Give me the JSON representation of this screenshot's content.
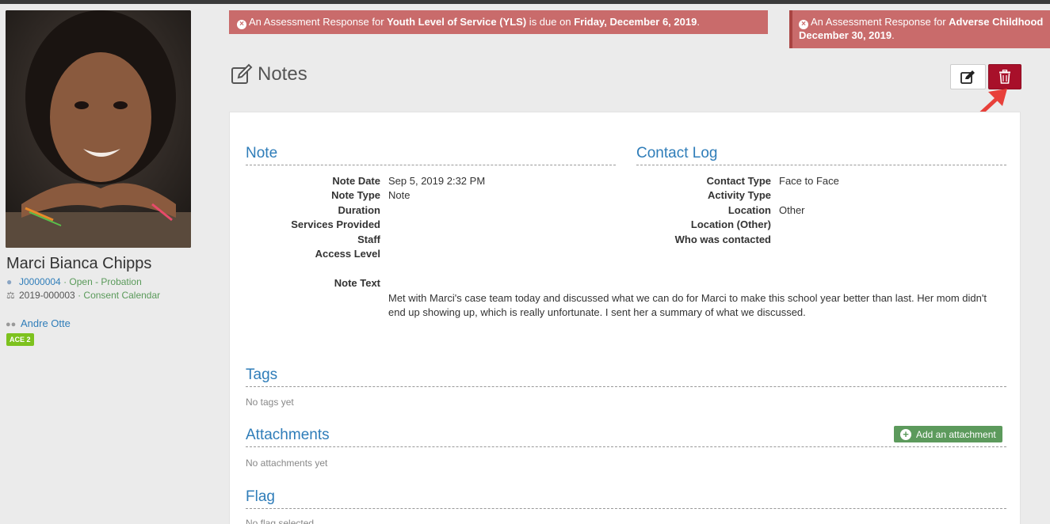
{
  "alerts": [
    {
      "prefix": "An Assessment Response for ",
      "assessment": "Youth Level of Service (YLS)",
      "middle": " is due on ",
      "due": "Friday, December 6, 2019",
      "suffix": "."
    },
    {
      "prefix": "An Assessment Response for ",
      "assessment": "Adverse Childhood",
      "due": "December 30, 2019",
      "suffix": "."
    }
  ],
  "profile": {
    "name": "Marci Bianca Chipps",
    "case_id": "J0000004",
    "case_status": "· Open - Probation",
    "court_id": "2019-000003",
    "court_calendar": "· Consent Calendar",
    "officer": "Andre Otte",
    "badge": "ACE 2"
  },
  "header": {
    "title": "Notes"
  },
  "note": {
    "title": "Note",
    "fields": [
      {
        "label": "Note Date",
        "value": "Sep 5, 2019 2:32 PM"
      },
      {
        "label": "Note Type",
        "value": "Note"
      },
      {
        "label": "Duration",
        "value": ""
      },
      {
        "label": "Services Provided",
        "value": ""
      },
      {
        "label": "Staff",
        "value": ""
      },
      {
        "label": "Access Level",
        "value": ""
      }
    ],
    "text_label": "Note Text",
    "text": "Met with Marci's case team today and discussed what we can do for Marci  to make this school year better than last. Her mom didn't end up showing up, which is really unfortunate. I sent her a summary of what we discussed."
  },
  "contact_log": {
    "title": "Contact Log",
    "fields": [
      {
        "label": "Contact Type",
        "value": "Face to Face"
      },
      {
        "label": "Activity Type",
        "value": ""
      },
      {
        "label": "Location",
        "value": "Other"
      },
      {
        "label": "Location (Other)",
        "value": ""
      },
      {
        "label": "Who was contacted",
        "value": ""
      }
    ]
  },
  "tags": {
    "title": "Tags",
    "empty": "No tags yet"
  },
  "attachments": {
    "title": "Attachments",
    "add_label": "Add an attachment",
    "empty": "No attachments yet"
  },
  "flag": {
    "title": "Flag",
    "empty": "No flag selected"
  },
  "colors": {
    "delete": "#a8102a",
    "alert": "#c96b6b",
    "link": "#2f7db9",
    "success": "#5c9a5c",
    "badge": "#7dc21e"
  }
}
